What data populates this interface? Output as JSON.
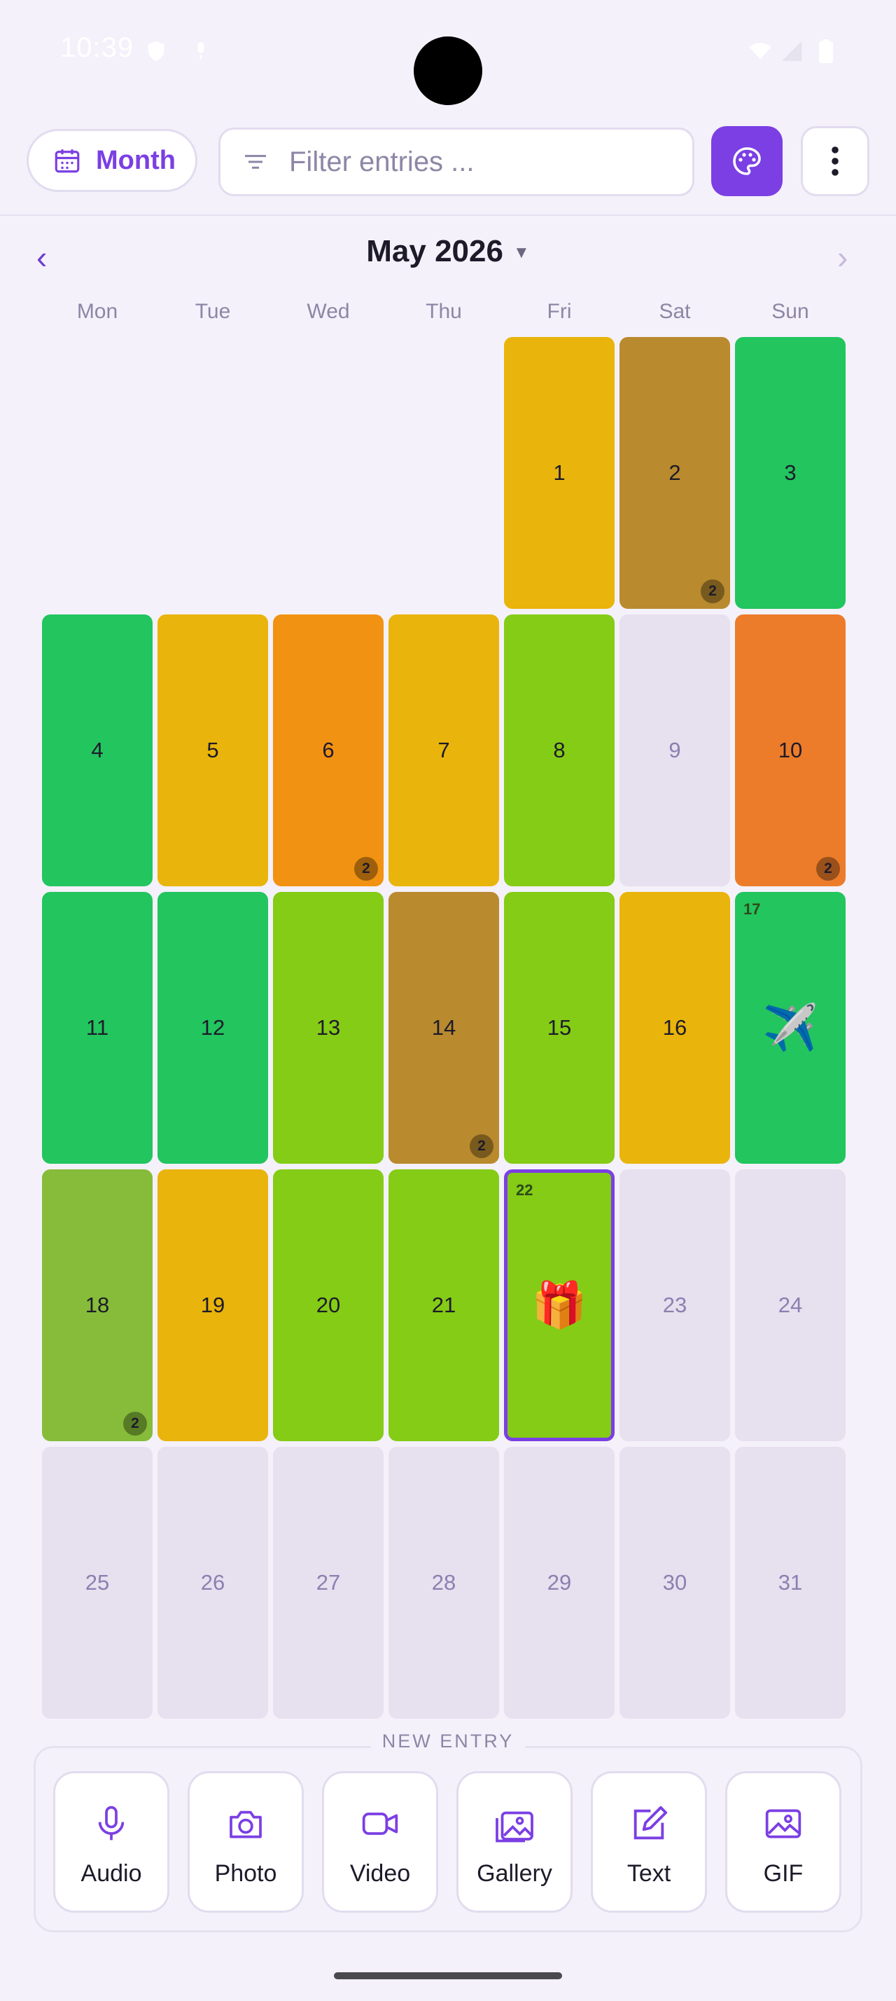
{
  "status_bar": {
    "time": "10:39"
  },
  "toolbar": {
    "view_label": "Month",
    "filter_placeholder": "Filter entries ...",
    "colors": {
      "accent": "#7b3fe4"
    }
  },
  "calendar": {
    "month_title": "May 2026",
    "weekdays": [
      "Mon",
      "Tue",
      "Wed",
      "Thu",
      "Fri",
      "Sat",
      "Sun"
    ],
    "days": [
      {
        "day": "1",
        "color": "#e9b40b"
      },
      {
        "day": "2",
        "color": "#b98a2e",
        "badge": "2"
      },
      {
        "day": "3",
        "color": "#22c55e"
      },
      {
        "day": "4",
        "color": "#22c55e"
      },
      {
        "day": "5",
        "color": "#e9b40b"
      },
      {
        "day": "6",
        "color": "#f29212",
        "badge": "2"
      },
      {
        "day": "7",
        "color": "#e9b40b"
      },
      {
        "day": "8",
        "color": "#84cc16"
      },
      {
        "day": "9",
        "empty": true
      },
      {
        "day": "10",
        "color": "#ec7c2a",
        "badge": "2"
      },
      {
        "day": "11",
        "color": "#22c55e"
      },
      {
        "day": "12",
        "color": "#22c55e"
      },
      {
        "day": "13",
        "color": "#84cc16"
      },
      {
        "day": "14",
        "color": "#b98a2e",
        "badge": "2"
      },
      {
        "day": "15",
        "color": "#84cc16"
      },
      {
        "day": "16",
        "color": "#e9b40b"
      },
      {
        "day": "17",
        "color": "#22c55e",
        "emoji": "✈️"
      },
      {
        "day": "18",
        "color": "#86bc3a",
        "badge": "2"
      },
      {
        "day": "19",
        "color": "#e9b40b"
      },
      {
        "day": "20",
        "color": "#84cc16"
      },
      {
        "day": "21",
        "color": "#84cc16"
      },
      {
        "day": "22",
        "color": "#84cc16",
        "emoji": "🎁",
        "today": true
      },
      {
        "day": "23",
        "empty": true
      },
      {
        "day": "24",
        "empty": true
      },
      {
        "day": "25",
        "empty": true
      },
      {
        "day": "26",
        "empty": true
      },
      {
        "day": "27",
        "empty": true
      },
      {
        "day": "28",
        "empty": true
      },
      {
        "day": "29",
        "empty": true
      },
      {
        "day": "30",
        "empty": true
      },
      {
        "day": "31",
        "empty": true
      }
    ],
    "empty_color": "#e7e0ef"
  },
  "new_entry": {
    "title": "NEW ENTRY",
    "buttons": [
      {
        "label": "Audio",
        "icon": "microphone-icon"
      },
      {
        "label": "Photo",
        "icon": "camera-icon"
      },
      {
        "label": "Video",
        "icon": "video-icon"
      },
      {
        "label": "Gallery",
        "icon": "gallery-icon"
      },
      {
        "label": "Text",
        "icon": "edit-icon"
      },
      {
        "label": "GIF",
        "icon": "image-icon"
      }
    ]
  }
}
